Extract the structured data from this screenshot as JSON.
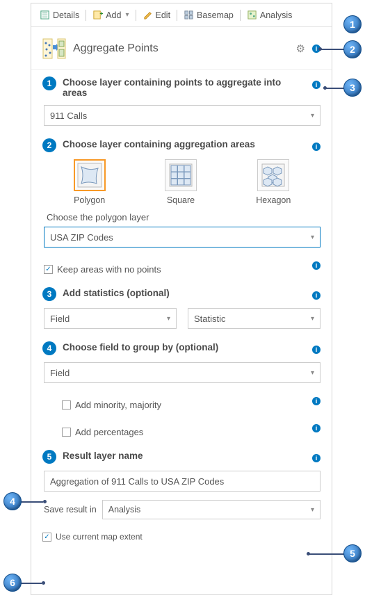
{
  "toolbar": {
    "details": "Details",
    "add": "Add",
    "edit": "Edit",
    "basemap": "Basemap",
    "analysis": "Analysis"
  },
  "header": {
    "title": "Aggregate Points"
  },
  "step1": {
    "title": "Choose layer containing points to aggregate into areas",
    "value": "911 Calls"
  },
  "step2": {
    "title": "Choose layer containing aggregation areas",
    "shapes": {
      "polygon": "Polygon",
      "square": "Square",
      "hexagon": "Hexagon"
    },
    "sub_label": "Choose the polygon layer",
    "value": "USA ZIP Codes",
    "keep": "Keep areas with no points"
  },
  "step3": {
    "title": "Add statistics (optional)",
    "field": "Field",
    "statistic": "Statistic"
  },
  "step4": {
    "title": "Choose field to group by (optional)",
    "field": "Field",
    "minority": "Add minority, majority",
    "percentages": "Add percentages"
  },
  "step5": {
    "title": "Result layer name",
    "value": "Aggregation of 911 Calls to USA ZIP Codes",
    "save_label": "Save result in",
    "save_value": "Analysis"
  },
  "extent": "Use current map extent",
  "callouts": {
    "c1": "1",
    "c2": "2",
    "c3": "3",
    "c4": "4",
    "c5": "5",
    "c6": "6"
  }
}
